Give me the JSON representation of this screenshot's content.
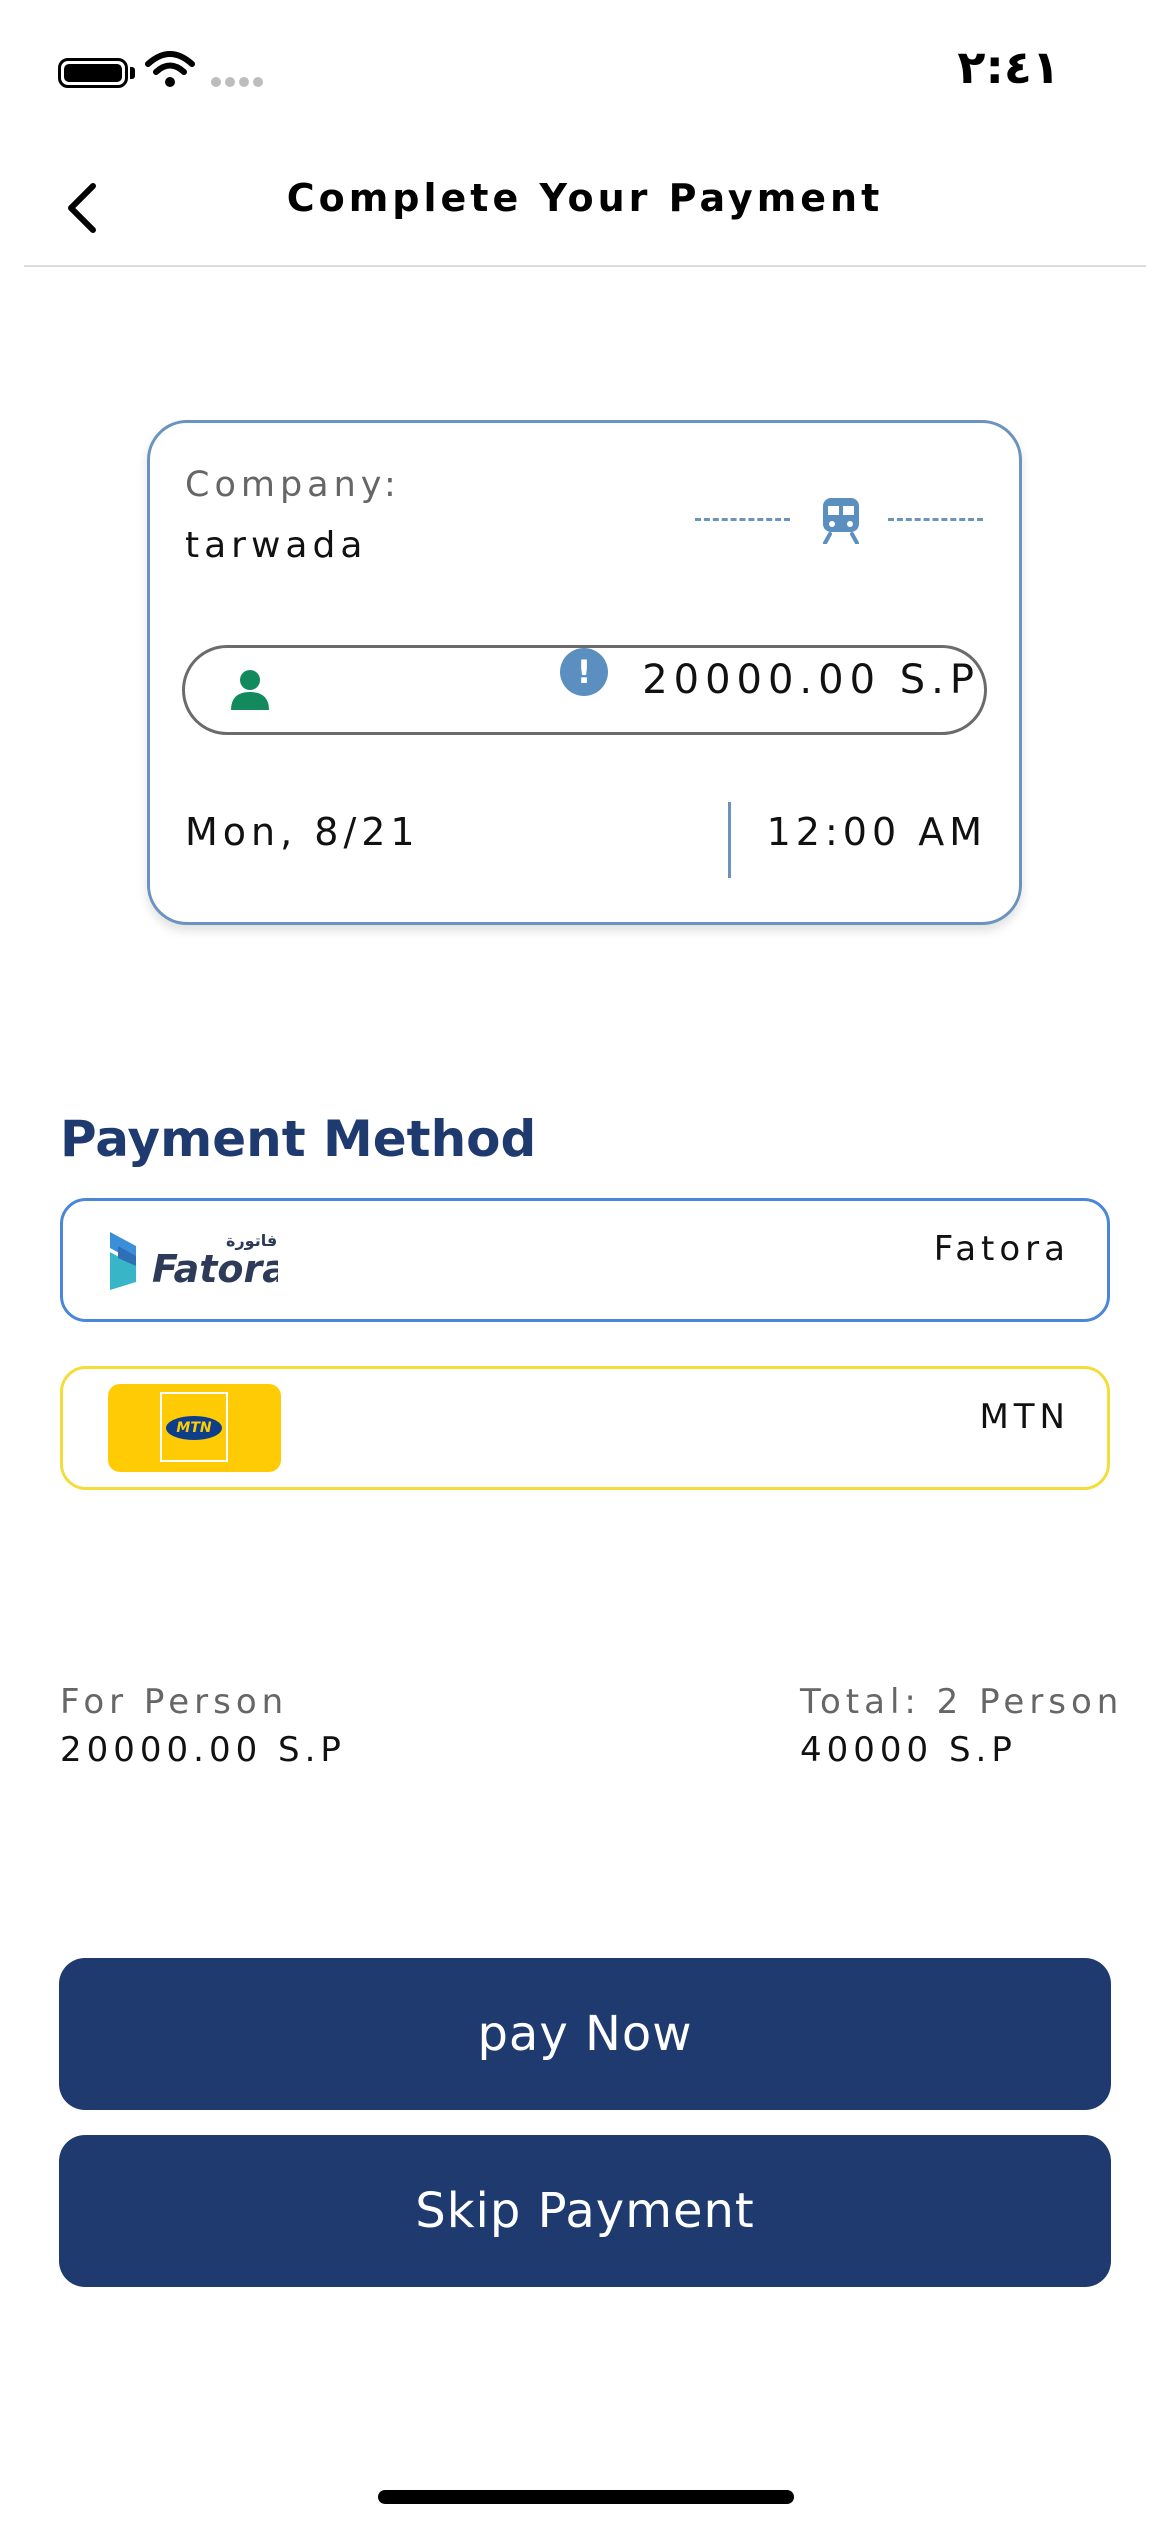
{
  "status_bar": {
    "time": "٢:٤١",
    "icons": [
      "battery-icon",
      "wifi-icon",
      "signal-icon"
    ]
  },
  "header": {
    "title": "Complete Your Payment",
    "back_icon": "chevron-left-icon"
  },
  "trip_card": {
    "company_label": "Company:",
    "company_name": "tarwada",
    "transport_icon": "train-icon",
    "person_icon": "person-icon",
    "alert_icon": "alert-icon",
    "alert_glyph": "!",
    "price": "20000.00 S.P",
    "date": "Mon, 8/21",
    "time": "12:00 AM"
  },
  "payment_method": {
    "title": "Payment Method",
    "options": [
      {
        "label": "Fatora",
        "logo_text": "Fatora",
        "logo_arabic": "فاتورة",
        "border_color": "#4a86d9"
      },
      {
        "label": "MTN",
        "logo_text": "MTN",
        "border_color": "#f3dd3a"
      }
    ]
  },
  "totals": {
    "per_person_label": "For Person",
    "per_person_value": "20000.00 S.P",
    "total_label": "Total: 2 Person",
    "total_value": "40000 S.P"
  },
  "buttons": {
    "pay": "pay Now",
    "skip": "Skip Payment"
  },
  "colors": {
    "primary": "#1e3a6e",
    "accent_blue": "#6a93bf",
    "person_green": "#138a5e",
    "mtn_yellow": "#ffcb05"
  }
}
